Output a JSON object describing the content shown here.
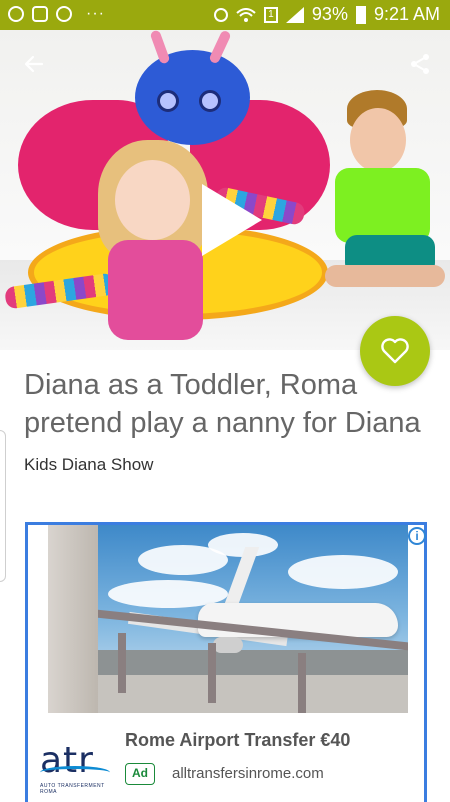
{
  "statusbar": {
    "battery": "93%",
    "time": "9:21 AM",
    "sim": "1",
    "dots": "···"
  },
  "video": {
    "title": "Diana as a Toddler, Roma pretend play a nanny for Diana",
    "channel": "Kids Diana Show"
  },
  "ad": {
    "headline": "Rome Airport Transfer €40",
    "badge": "Ad",
    "domain": "alltransfersinrome.com",
    "logo_text": "atr",
    "logo_subtext": "AUTO TRANSFERMENT ROMA",
    "info_glyph": "i"
  },
  "colors": {
    "accent": "#9aa90e",
    "fav_button": "#aac814",
    "ad_border": "#3b7de0",
    "ad_badge": "#1a8a3a"
  },
  "icons": [
    "back-arrow-icon",
    "share-icon",
    "play-icon",
    "heart-icon",
    "info-icon"
  ]
}
